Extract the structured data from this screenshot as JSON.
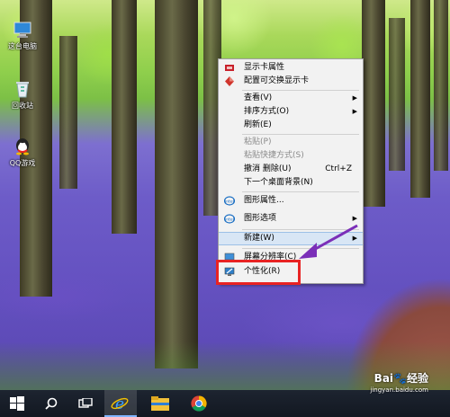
{
  "desktop": {
    "icons": [
      {
        "label": "这台电脑",
        "icon": "computer-icon"
      },
      {
        "label": "回收站",
        "icon": "recycle-bin-icon"
      },
      {
        "label": "QQ游戏",
        "icon": "qq-game-icon"
      }
    ]
  },
  "context_menu": {
    "items": [
      {
        "label": "显示卡属性",
        "icon": "graphics-card-icon",
        "enabled": true
      },
      {
        "label": "配置可交换显示卡",
        "icon": "diamond-icon",
        "enabled": true
      },
      {
        "label": "查看(V)",
        "submenu": true,
        "enabled": true
      },
      {
        "label": "排序方式(O)",
        "submenu": true,
        "enabled": true
      },
      {
        "label": "刷新(E)",
        "enabled": true
      },
      {
        "label": "粘贴(P)",
        "enabled": false
      },
      {
        "label": "粘贴快捷方式(S)",
        "enabled": false
      },
      {
        "label": "撤消 删除(U)",
        "shortcut": "Ctrl+Z",
        "enabled": true
      },
      {
        "label": "下一个桌面背景(N)",
        "enabled": true
      },
      {
        "label": "图形属性...",
        "icon": "intel-icon",
        "enabled": true
      },
      {
        "label": "图形选项",
        "icon": "intel-icon",
        "submenu": true,
        "enabled": true
      },
      {
        "label": "新建(W)",
        "submenu": true,
        "enabled": true,
        "highlighted": true
      },
      {
        "label": "屏幕分辨率(C)",
        "icon": "display-icon",
        "enabled": true
      },
      {
        "label": "个性化(R)",
        "icon": "personalize-icon",
        "enabled": true
      }
    ]
  },
  "annotation": {
    "highlight_color": "#e82323",
    "arrow_color": "#7b2fb8"
  },
  "taskbar": {
    "items": [
      {
        "icon": "windows-start-icon"
      },
      {
        "icon": "search-icon"
      },
      {
        "icon": "task-view-icon"
      },
      {
        "icon": "internet-explorer-icon",
        "active": true
      },
      {
        "icon": "file-explorer-icon"
      },
      {
        "icon": "chrome-icon"
      }
    ]
  },
  "watermark": {
    "brand": "Bai",
    "brand_cn": "经验",
    "url": "jingyan.baidu.com"
  }
}
